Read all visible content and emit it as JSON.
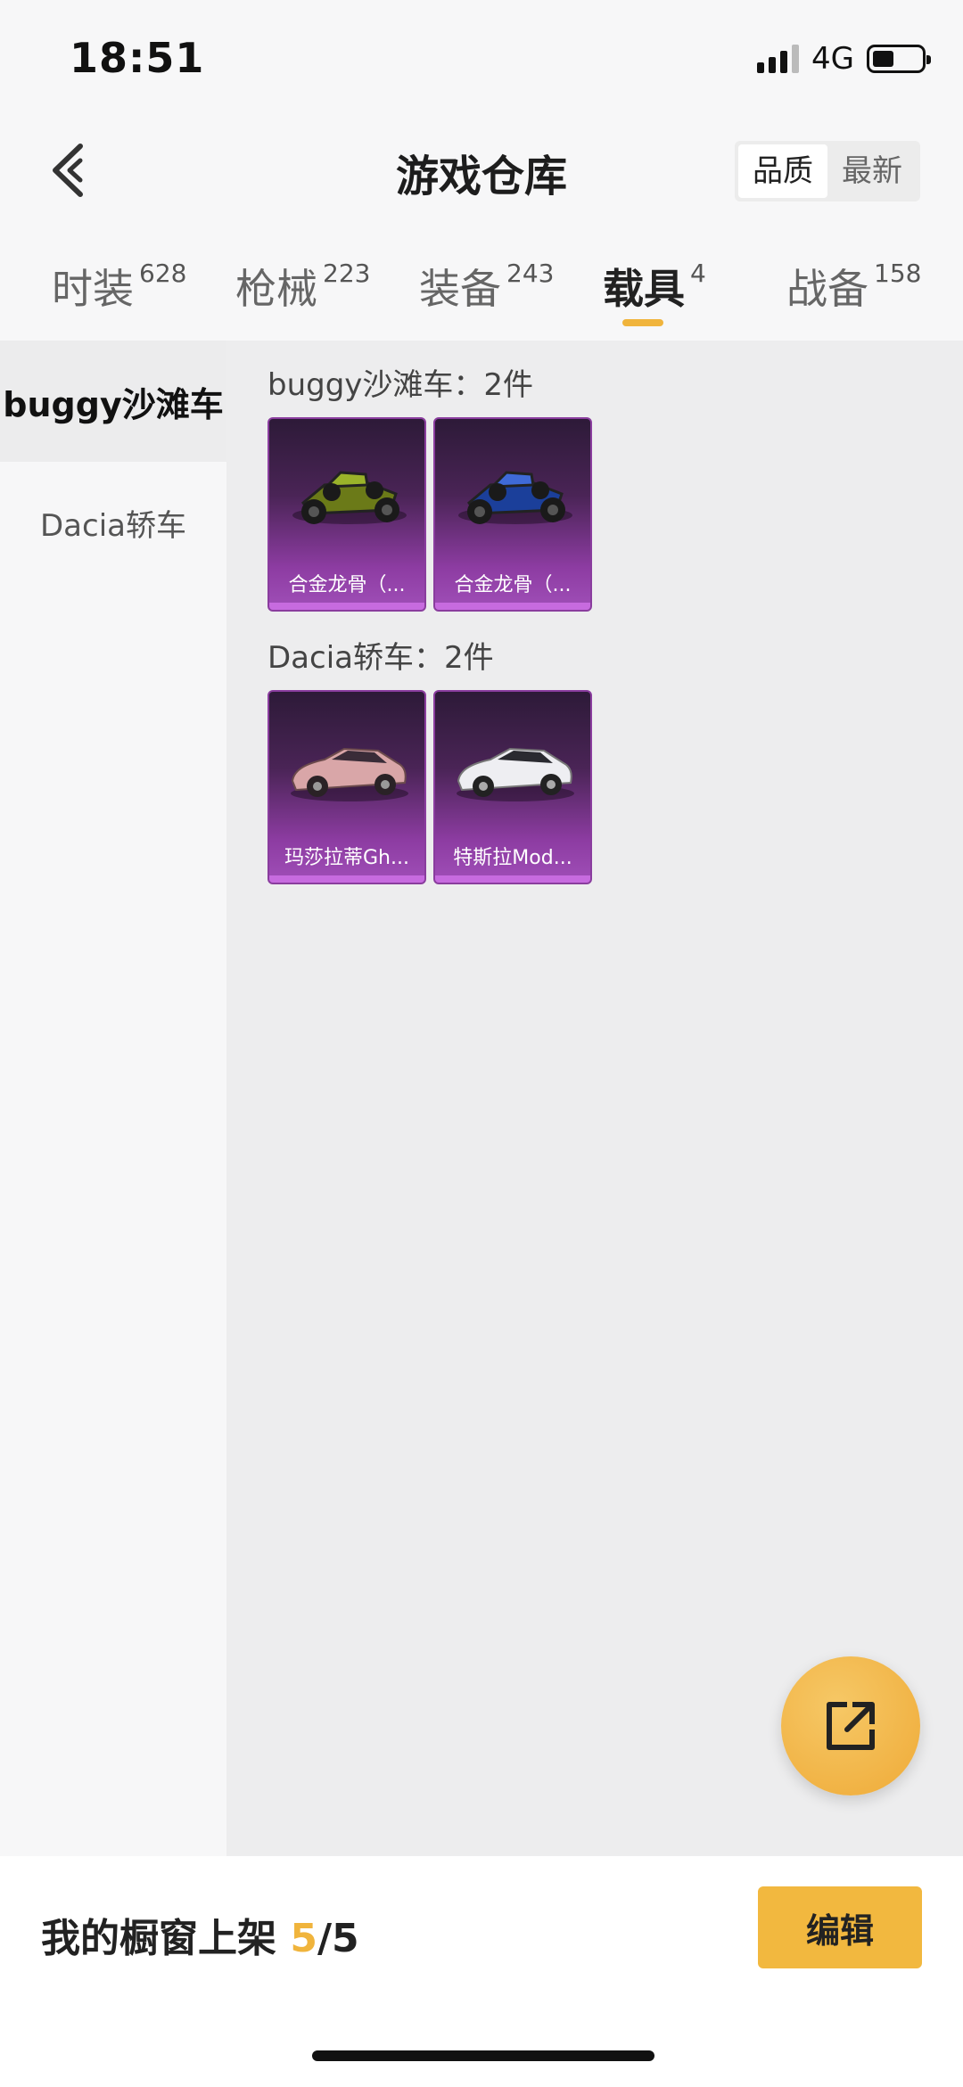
{
  "status_bar": {
    "time": "18:51",
    "network": "4G"
  },
  "header": {
    "title": "游戏仓库",
    "sort_options": [
      "品质",
      "最新"
    ],
    "active_sort": "品质"
  },
  "tabs": [
    {
      "label": "时装",
      "count": "628"
    },
    {
      "label": "枪械",
      "count": "223"
    },
    {
      "label": "装备",
      "count": "243"
    },
    {
      "label": "载具",
      "count": "4"
    },
    {
      "label": "战备",
      "count": "158"
    }
  ],
  "active_tab": "载具",
  "sidebar": {
    "items": [
      {
        "label": "buggy沙滩车"
      },
      {
        "label": "Dacia轿车"
      }
    ]
  },
  "groups": [
    {
      "title": "buggy沙滩车：2件",
      "items": [
        {
          "name": "合金龙骨（..."
        },
        {
          "name": "合金龙骨（..."
        }
      ]
    },
    {
      "title": "Dacia轿车：2件",
      "items": [
        {
          "name": "玛莎拉蒂Gh..."
        },
        {
          "name": "特斯拉Mod..."
        }
      ]
    }
  ],
  "footer": {
    "label": "我的橱窗上架",
    "count": "5",
    "total": "/5",
    "edit_label": "编辑"
  },
  "colors": {
    "accent": "#f0b43c",
    "card_purple": "#8d3ca2"
  },
  "icons": {
    "back": "chevron-left-icon",
    "share": "share-external-icon"
  }
}
